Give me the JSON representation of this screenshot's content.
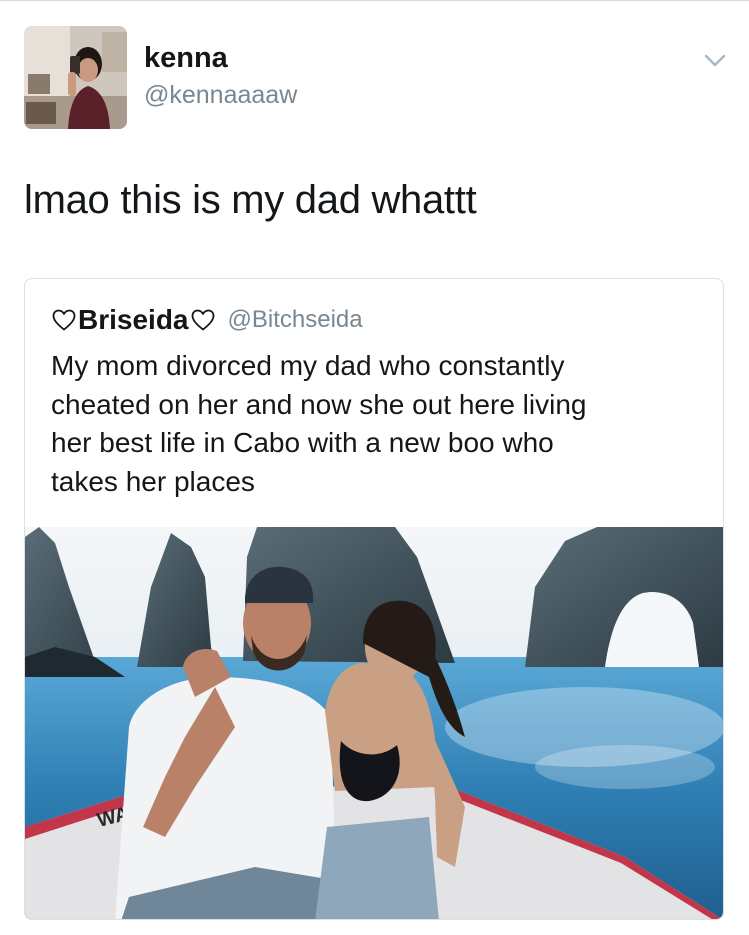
{
  "tweet": {
    "author": {
      "display_name": "kenna",
      "handle": "@kennaaaaw",
      "avatar_icon": "profile-photo"
    },
    "menu_icon": "chevron-down-icon",
    "text": "lmao this is my dad whattt"
  },
  "quoted_tweet": {
    "author": {
      "display_name": "Briseida",
      "name_decoration_icon": "heart-outline-icon",
      "handle": "@Bitchseida"
    },
    "text_lines": [
      "My mom divorced my dad who constantly",
      "cheated on her and now she out here living",
      "her best life in Cabo with a new boo who",
      "takes her places"
    ],
    "photo": {
      "boat_lettering": "WATC"
    }
  },
  "colors": {
    "text_primary": "#14171a",
    "text_secondary": "#7a8791",
    "border": "#dbe0e4",
    "sea": "#2f7fb4",
    "sky": "#f2f6f8",
    "boat_trim": "#c2364a"
  }
}
